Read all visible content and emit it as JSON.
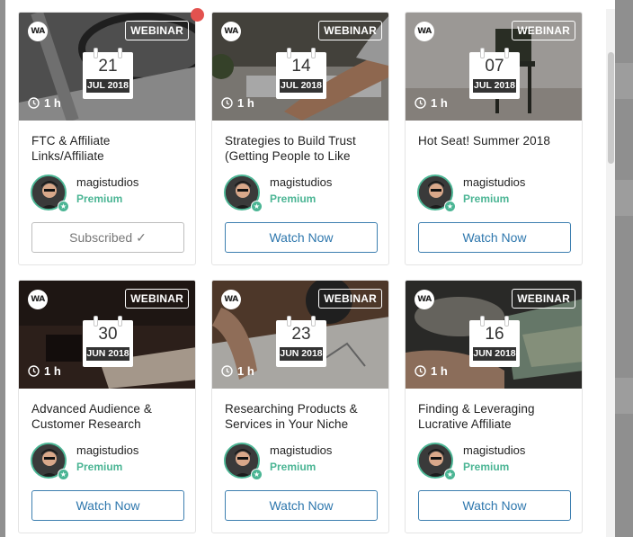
{
  "cards": [
    {
      "badge": "WEBINAR",
      "day": "21",
      "month": "JUL 2018",
      "duration": "1 h",
      "title": "FTC & Affiliate Links/Affiliate",
      "author": "magistudios",
      "tier": "Premium",
      "button": "Subscribed ✓",
      "state": "subscribed"
    },
    {
      "badge": "WEBINAR",
      "day": "14",
      "month": "JUL 2018",
      "duration": "1 h",
      "title": "Strategies to Build Trust (Getting People to Like",
      "author": "magistudios",
      "tier": "Premium",
      "button": "Watch Now",
      "state": "watch"
    },
    {
      "badge": "WEBINAR",
      "day": "07",
      "month": "JUL 2018",
      "duration": "1 h",
      "title": "Hot Seat! Summer 2018",
      "author": "magistudios",
      "tier": "Premium",
      "button": "Watch Now",
      "state": "watch"
    },
    {
      "badge": "WEBINAR",
      "day": "30",
      "month": "JUN 2018",
      "duration": "1 h",
      "title": "Advanced Audience & Customer Research",
      "author": "magistudios",
      "tier": "Premium",
      "button": "Watch Now",
      "state": "watch"
    },
    {
      "badge": "WEBINAR",
      "day": "23",
      "month": "JUN 2018",
      "duration": "1 h",
      "title": "Researching Products & Services in Your Niche",
      "author": "magistudios",
      "tier": "Premium",
      "button": "Watch Now",
      "state": "watch"
    },
    {
      "badge": "WEBINAR",
      "day": "16",
      "month": "JUN 2018",
      "duration": "1 h",
      "title": "Finding & Leveraging Lucrative Affiliate",
      "author": "magistudios",
      "tier": "Premium",
      "button": "Watch Now",
      "state": "watch"
    }
  ],
  "logo_text": "WA",
  "colors": {
    "accent": "#2e77ad",
    "premium": "#4bb594",
    "notification": "#e3524f"
  }
}
